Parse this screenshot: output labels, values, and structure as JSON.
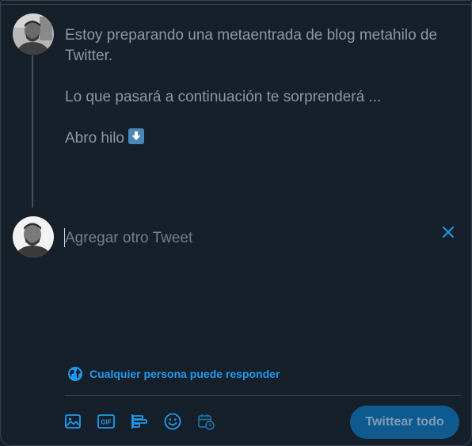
{
  "thread": {
    "first_tweet": {
      "line1": "Estoy preparando una metaentrada de blog metahilo de Twitter.",
      "line2": "Lo que pasará a continuación te sorprenderá ...",
      "line3": "Abro hilo",
      "emoji_icon": "down-arrow-icon"
    },
    "second_tweet": {
      "placeholder": "Agregar otro Tweet",
      "value": ""
    }
  },
  "reply_setting": {
    "label": "Cualquier persona puede responder",
    "icon": "globe-icon"
  },
  "toolbar": {
    "icons": [
      "image-icon",
      "gif-icon",
      "poll-icon",
      "emoji-icon",
      "schedule-icon"
    ],
    "gif_label": "GIF",
    "submit_label": "Twittear todo"
  },
  "colors": {
    "background": "#15202b",
    "accent": "#1d9bf0",
    "muted_text": "#8b98a5",
    "thread_line": "#3d5466",
    "disabled_button": "#0f5a8f"
  }
}
